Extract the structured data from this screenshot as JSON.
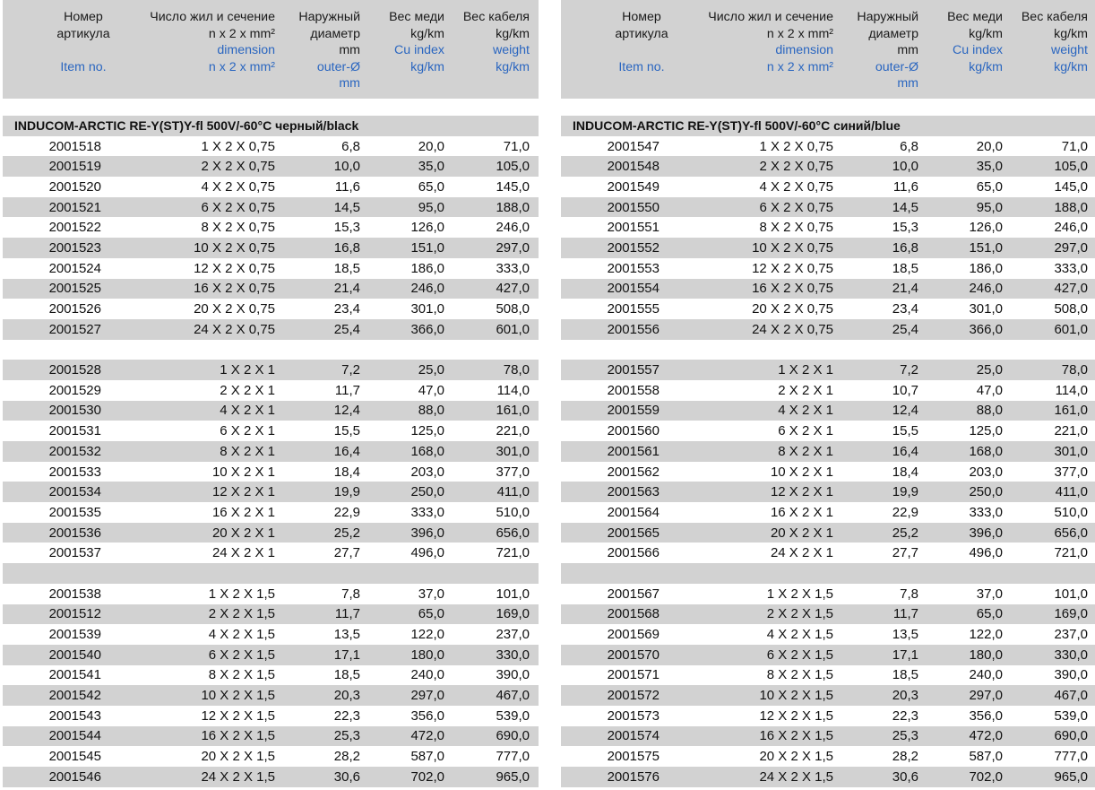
{
  "header": {
    "item": {
      "ru": [
        "Номер",
        "артикула"
      ],
      "en": [
        "",
        "Item no."
      ]
    },
    "dim": {
      "ru": [
        "Число жил и сечение",
        "n x 2 x mm²"
      ],
      "en": [
        "dimension",
        "n x 2 x mm²"
      ]
    },
    "diam": {
      "ru": [
        "Наружный",
        "диаметр",
        "mm"
      ],
      "en": [
        "outer-Ø",
        "mm"
      ]
    },
    "cu": {
      "ru": [
        "Вес меди",
        "kg/km"
      ],
      "en": [
        "Cu index",
        "kg/km"
      ]
    },
    "wt": {
      "ru": [
        "Вес кабеля",
        "kg/km"
      ],
      "en": [
        "weight",
        "kg/km"
      ]
    }
  },
  "left": {
    "title": "INDUCOM-ARCTIC RE-Y(ST)Y-fl 500V/-60°C черный/black",
    "groups": [
      [
        [
          "2001518",
          "1 X 2 X 0,75",
          "6,8",
          "20,0",
          "71,0"
        ],
        [
          "2001519",
          "2 X 2 X 0,75",
          "10,0",
          "35,0",
          "105,0"
        ],
        [
          "2001520",
          "4 X 2 X 0,75",
          "11,6",
          "65,0",
          "145,0"
        ],
        [
          "2001521",
          "6 X 2 X 0,75",
          "14,5",
          "95,0",
          "188,0"
        ],
        [
          "2001522",
          "8 X 2 X 0,75",
          "15,3",
          "126,0",
          "246,0"
        ],
        [
          "2001523",
          "10 X 2 X 0,75",
          "16,8",
          "151,0",
          "297,0"
        ],
        [
          "2001524",
          "12 X 2 X 0,75",
          "18,5",
          "186,0",
          "333,0"
        ],
        [
          "2001525",
          "16 X 2 X 0,75",
          "21,4",
          "246,0",
          "427,0"
        ],
        [
          "2001526",
          "20 X 2 X 0,75",
          "23,4",
          "301,0",
          "508,0"
        ],
        [
          "2001527",
          "24 X 2 X 0,75",
          "25,4",
          "366,0",
          "601,0"
        ]
      ],
      [
        [
          "2001528",
          "1 X 2 X 1",
          "7,2",
          "25,0",
          "78,0"
        ],
        [
          "2001529",
          "2 X 2 X 1",
          "11,7",
          "47,0",
          "114,0"
        ],
        [
          "2001530",
          "4 X 2 X 1",
          "12,4",
          "88,0",
          "161,0"
        ],
        [
          "2001531",
          "6 X 2 X 1",
          "15,5",
          "125,0",
          "221,0"
        ],
        [
          "2001532",
          "8 X 2 X 1",
          "16,4",
          "168,0",
          "301,0"
        ],
        [
          "2001533",
          "10 X 2 X 1",
          "18,4",
          "203,0",
          "377,0"
        ],
        [
          "2001534",
          "12 X 2 X 1",
          "19,9",
          "250,0",
          "411,0"
        ],
        [
          "2001535",
          "16 X 2 X 1",
          "22,9",
          "333,0",
          "510,0"
        ],
        [
          "2001536",
          "20 X 2 X 1",
          "25,2",
          "396,0",
          "656,0"
        ],
        [
          "2001537",
          "24 X 2 X 1",
          "27,7",
          "496,0",
          "721,0"
        ]
      ],
      [
        [
          "2001538",
          "1 X 2 X 1,5",
          "7,8",
          "37,0",
          "101,0"
        ],
        [
          "2001512",
          "2 X 2 X 1,5",
          "11,7",
          "65,0",
          "169,0"
        ],
        [
          "2001539",
          "4 X 2 X 1,5",
          "13,5",
          "122,0",
          "237,0"
        ],
        [
          "2001540",
          "6 X 2 X 1,5",
          "17,1",
          "180,0",
          "330,0"
        ],
        [
          "2001541",
          "8 X 2 X 1,5",
          "18,5",
          "240,0",
          "390,0"
        ],
        [
          "2001542",
          "10 X 2 X 1,5",
          "20,3",
          "297,0",
          "467,0"
        ],
        [
          "2001543",
          "12 X 2 X 1,5",
          "22,3",
          "356,0",
          "539,0"
        ],
        [
          "2001544",
          "16 X 2 X 1,5",
          "25,3",
          "472,0",
          "690,0"
        ],
        [
          "2001545",
          "20 X 2 X 1,5",
          "28,2",
          "587,0",
          "777,0"
        ],
        [
          "2001546",
          "24 X 2 X 1,5",
          "30,6",
          "702,0",
          "965,0"
        ]
      ]
    ]
  },
  "right": {
    "title": "INDUCOM-ARCTIC RE-Y(ST)Y-fl 500V/-60°C синий/blue",
    "groups": [
      [
        [
          "2001547",
          "1 X 2 X 0,75",
          "6,8",
          "20,0",
          "71,0"
        ],
        [
          "2001548",
          "2 X 2 X 0,75",
          "10,0",
          "35,0",
          "105,0"
        ],
        [
          "2001549",
          "4 X 2 X 0,75",
          "11,6",
          "65,0",
          "145,0"
        ],
        [
          "2001550",
          "6 X 2 X 0,75",
          "14,5",
          "95,0",
          "188,0"
        ],
        [
          "2001551",
          "8 X 2 X 0,75",
          "15,3",
          "126,0",
          "246,0"
        ],
        [
          "2001552",
          "10 X 2 X 0,75",
          "16,8",
          "151,0",
          "297,0"
        ],
        [
          "2001553",
          "12 X 2 X 0,75",
          "18,5",
          "186,0",
          "333,0"
        ],
        [
          "2001554",
          "16 X 2 X 0,75",
          "21,4",
          "246,0",
          "427,0"
        ],
        [
          "2001555",
          "20 X 2 X 0,75",
          "23,4",
          "301,0",
          "508,0"
        ],
        [
          "2001556",
          "24 X 2 X 0,75",
          "25,4",
          "366,0",
          "601,0"
        ]
      ],
      [
        [
          "2001557",
          "1 X 2 X 1",
          "7,2",
          "25,0",
          "78,0"
        ],
        [
          "2001558",
          "2 X 2 X 1",
          "10,7",
          "47,0",
          "114,0"
        ],
        [
          "2001559",
          "4 X 2 X 1",
          "12,4",
          "88,0",
          "161,0"
        ],
        [
          "2001560",
          "6 X 2 X 1",
          "15,5",
          "125,0",
          "221,0"
        ],
        [
          "2001561",
          "8 X 2 X 1",
          "16,4",
          "168,0",
          "301,0"
        ],
        [
          "2001562",
          "10 X 2 X 1",
          "18,4",
          "203,0",
          "377,0"
        ],
        [
          "2001563",
          "12 X 2 X 1",
          "19,9",
          "250,0",
          "411,0"
        ],
        [
          "2001564",
          "16 X 2 X 1",
          "22,9",
          "333,0",
          "510,0"
        ],
        [
          "2001565",
          "20 X 2 X 1",
          "25,2",
          "396,0",
          "656,0"
        ],
        [
          "2001566",
          "24 X 2 X 1",
          "27,7",
          "496,0",
          "721,0"
        ]
      ],
      [
        [
          "2001567",
          "1 X 2 X 1,5",
          "7,8",
          "37,0",
          "101,0"
        ],
        [
          "2001568",
          "2 X 2 X 1,5",
          "11,7",
          "65,0",
          "169,0"
        ],
        [
          "2001569",
          "4 X 2 X 1,5",
          "13,5",
          "122,0",
          "237,0"
        ],
        [
          "2001570",
          "6 X 2 X 1,5",
          "17,1",
          "180,0",
          "330,0"
        ],
        [
          "2001571",
          "8 X 2 X 1,5",
          "18,5",
          "240,0",
          "390,0"
        ],
        [
          "2001572",
          "10 X 2 X 1,5",
          "20,3",
          "297,0",
          "467,0"
        ],
        [
          "2001573",
          "12 X 2 X 1,5",
          "22,3",
          "356,0",
          "539,0"
        ],
        [
          "2001574",
          "16 X 2 X 1,5",
          "25,3",
          "472,0",
          "690,0"
        ],
        [
          "2001575",
          "20 X 2 X 1,5",
          "28,2",
          "587,0",
          "777,0"
        ],
        [
          "2001576",
          "24 X 2 X 1,5",
          "30,6",
          "702,0",
          "965,0"
        ]
      ]
    ]
  },
  "colors": {
    "shade": "#d2d2d2",
    "english_label": "#2a66c0"
  }
}
